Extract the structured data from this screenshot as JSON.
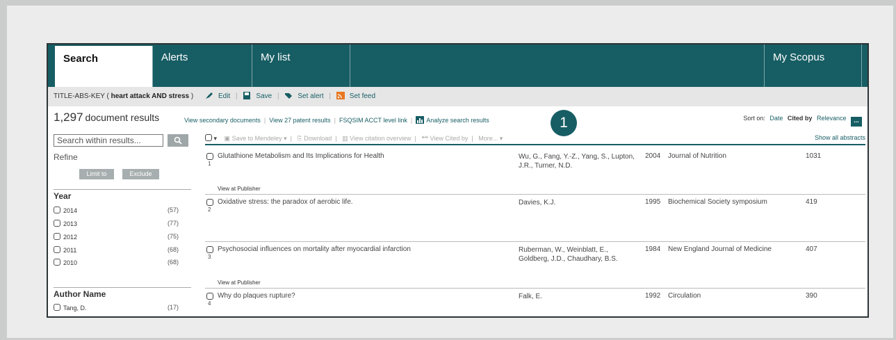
{
  "nav": {
    "tabs": [
      {
        "label": "Search",
        "active": true
      },
      {
        "label": "Alerts",
        "active": false
      },
      {
        "label": "My list",
        "active": false
      }
    ],
    "my_scopus": "My Scopus"
  },
  "query": {
    "prefix": "TITLE-ABS-KEY (",
    "terms": "heart attack AND stress",
    "suffix": ")",
    "actions": [
      "Edit",
      "Save",
      "Set alert",
      "Set feed"
    ]
  },
  "results": {
    "count": "1,297",
    "count_label": "document results",
    "links": [
      "View secondary documents",
      "View 27 patent results",
      "FSQSIM ACCT level link",
      "Analyze search results"
    ],
    "callout_number": "1",
    "sort_label": "Sort on:",
    "sort_options": [
      "Date",
      "Cited by",
      "Relevance"
    ],
    "more_button": "..."
  },
  "refine": {
    "search_placeholder": "Search within results...",
    "title": "Refine",
    "limit_to": "Limit to",
    "exclude": "Exclude",
    "year_heading": "Year",
    "years": [
      {
        "label": "2014",
        "count": "(57)"
      },
      {
        "label": "2013",
        "count": "(77)"
      },
      {
        "label": "2012",
        "count": "(75)"
      },
      {
        "label": "2011",
        "count": "(68)"
      },
      {
        "label": "2010",
        "count": "(68)"
      }
    ],
    "author_heading": "Author Name",
    "authors": [
      {
        "label": "Tang, D.",
        "count": "(17)"
      }
    ]
  },
  "toolbar": {
    "actions": [
      "Save to Mendeley",
      "Download",
      "View citation overview",
      "View Cited by",
      "More..."
    ],
    "show_abstracts": "Show all abstracts"
  },
  "rows": [
    {
      "num": "1",
      "title": "Glutathione Metabolism and Its Implications for Health",
      "authors": "Wu, G., Fang, Y.-Z., Yang, S., Lupton, J.R., Turner, N.D.",
      "year": "2004",
      "source": "Journal of Nutrition",
      "cites": "1031",
      "publisher": "View at Publisher"
    },
    {
      "num": "2",
      "title": "Oxidative stress: the paradox of aerobic life.",
      "authors": "Davies, K.J.",
      "year": "1995",
      "source": "Biochemical Society symposium",
      "cites": "419",
      "publisher": ""
    },
    {
      "num": "3",
      "title": "Psychosocial influences on mortality after myocardial infarction",
      "authors": "Ruberman, W., Weinblatt, E., Goldberg, J.D., Chaudhary, B.S.",
      "year": "1984",
      "source": "New England Journal of Medicine",
      "cites": "407",
      "publisher": "View at Publisher"
    },
    {
      "num": "4",
      "title": "Why do plaques rupture?",
      "authors": "Falk, E.",
      "year": "1992",
      "source": "Circulation",
      "cites": "390",
      "publisher": ""
    }
  ],
  "colors": {
    "brand": "#175d64",
    "background": "#cbcdcd"
  }
}
